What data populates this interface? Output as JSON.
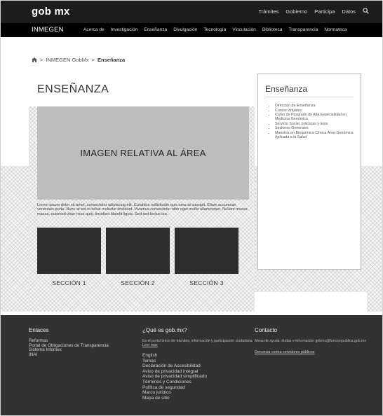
{
  "govbar": {
    "logo": "gob mx",
    "links": [
      "Trámites",
      "Gobierno",
      "Participa",
      "Datos"
    ]
  },
  "mainnav": {
    "brand": "INMEGEN",
    "items": [
      "Acerca de",
      "Investigación",
      "Enseñanza",
      "Divulgación",
      "Tecnología",
      "Vinculación",
      "Biblioteca",
      "Transparencia",
      "Normateca"
    ]
  },
  "breadcrumb": {
    "parent": "INMEGEN GobMx",
    "current": "Enseñanza",
    "sep1": ">",
    "sep2": ">"
  },
  "main": {
    "title": "ENSEÑANZA",
    "hero_text": "IMAGEN RELATIVA AL ÁREA",
    "lorem": "Lorem ipsum dolor sit amet, consectetur adipiscing elit. Curabitur sollicitudin quis urna at suscipit. Etiam accumsan venenatis porta. Nunc at est et tellus molestie tincidunt. Vivamus consectetur nibh eget mollis ullamcorper. Nullam massa massa, euismod vitae risus quis, tincidunt blandit ligula. Sed sed lectus leo.",
    "sections": [
      "SECCIÓN 1",
      "SECCIÓN 2",
      "SECCIÓN 3"
    ]
  },
  "sidebar": {
    "title": "Enseñanza",
    "items": [
      "Dirección de Enseñanza",
      "Cursos virtuales",
      "Curso de Posgrado de Alta Especialidad en Medicina Genómica",
      "Servicio Social, prácticas y tesis",
      "Sesiones Generales",
      "Maestría en Bioquímica Clínica Área Genómica Aplicada a la Salud"
    ]
  },
  "footer": {
    "enlaces": {
      "title": "Enlaces",
      "items": [
        "Reformas",
        "Portal de Obligaciones de Transparencia",
        "Sistema Infomex",
        "INAI"
      ]
    },
    "que_es": {
      "title": "¿Qué es gob.mx?",
      "desc": "Es el portal único de trámites, información y participación ciudadana.",
      "leer_mas": "Leer más",
      "items": [
        "English",
        "Temas",
        "Declaración de Accesibilidad",
        "Aviso de privacidad integral",
        "Aviso de privacidad simplificado",
        "Términos y Condiciones",
        "Política de seguridad",
        "Marco jurídico",
        "Mapa de sitio"
      ]
    },
    "contacto": {
      "title": "Contacto",
      "desc": "Mesa de ayuda: dudas e información gobmx@funcionpublica.gob.mx",
      "denuncia": "Denuncia contra servidores públicos"
    }
  },
  "colors": {
    "govbar_bg": "#1c1c1c",
    "nav_bg": "#000000",
    "hero_bg": "#bdbdbd",
    "thumb_bg": "#2d2d2d",
    "footer_bg": "#323232"
  },
  "icons": {
    "search": "search-icon",
    "home": "home-icon"
  }
}
